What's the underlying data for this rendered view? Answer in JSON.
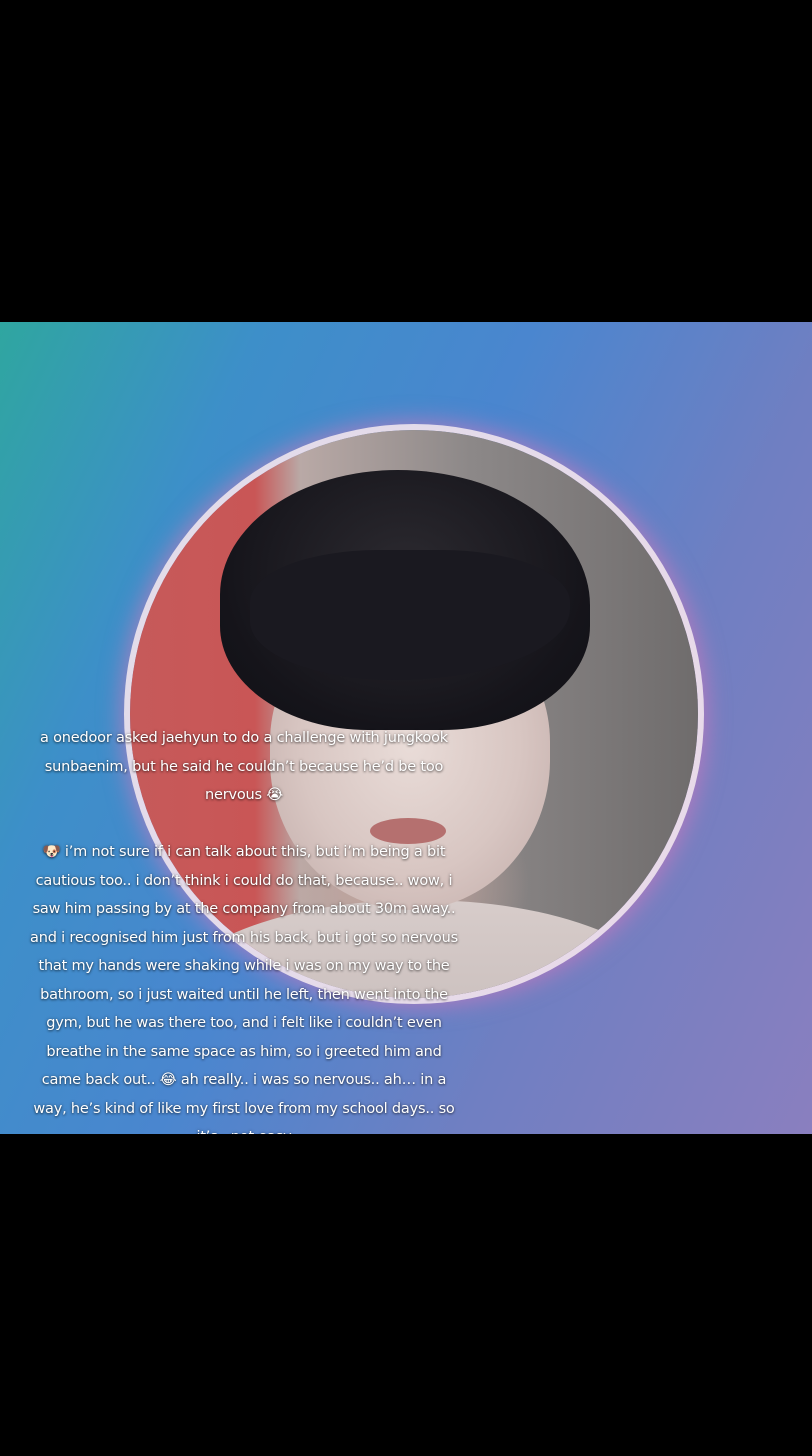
{
  "caption": {
    "intro": "a onedoor asked jaehyun to do a challenge with jungkook sunbaenim, but he said he couldn’t because he’d be too nervous 😭",
    "quote": "🐶 i’m not sure if i can talk about this, but i’m being a bit cautious too.. i don’t think i could do that, because.. wow, i saw him passing by at the company from about 30m away.. and i recognised him just from his back, but i got so nervous that my hands were shaking while i was on my way to the bathroom, so i just waited until he left, then went into the gym, but he was there too, and i felt like i couldn’t even breathe in the same space as him, so i greeted him and came back out.. 😂 ah really.. i was so nervous.. ah… in a way, he’s kind of like my first love from my school days.. so it’s.. not easy"
  },
  "colors": {
    "background_top": "#2fa6a0",
    "background_mid": "#4a86cf",
    "background_end": "#8a7fbf",
    "ring_glow": "#e678be",
    "letterbox": "#000000"
  }
}
